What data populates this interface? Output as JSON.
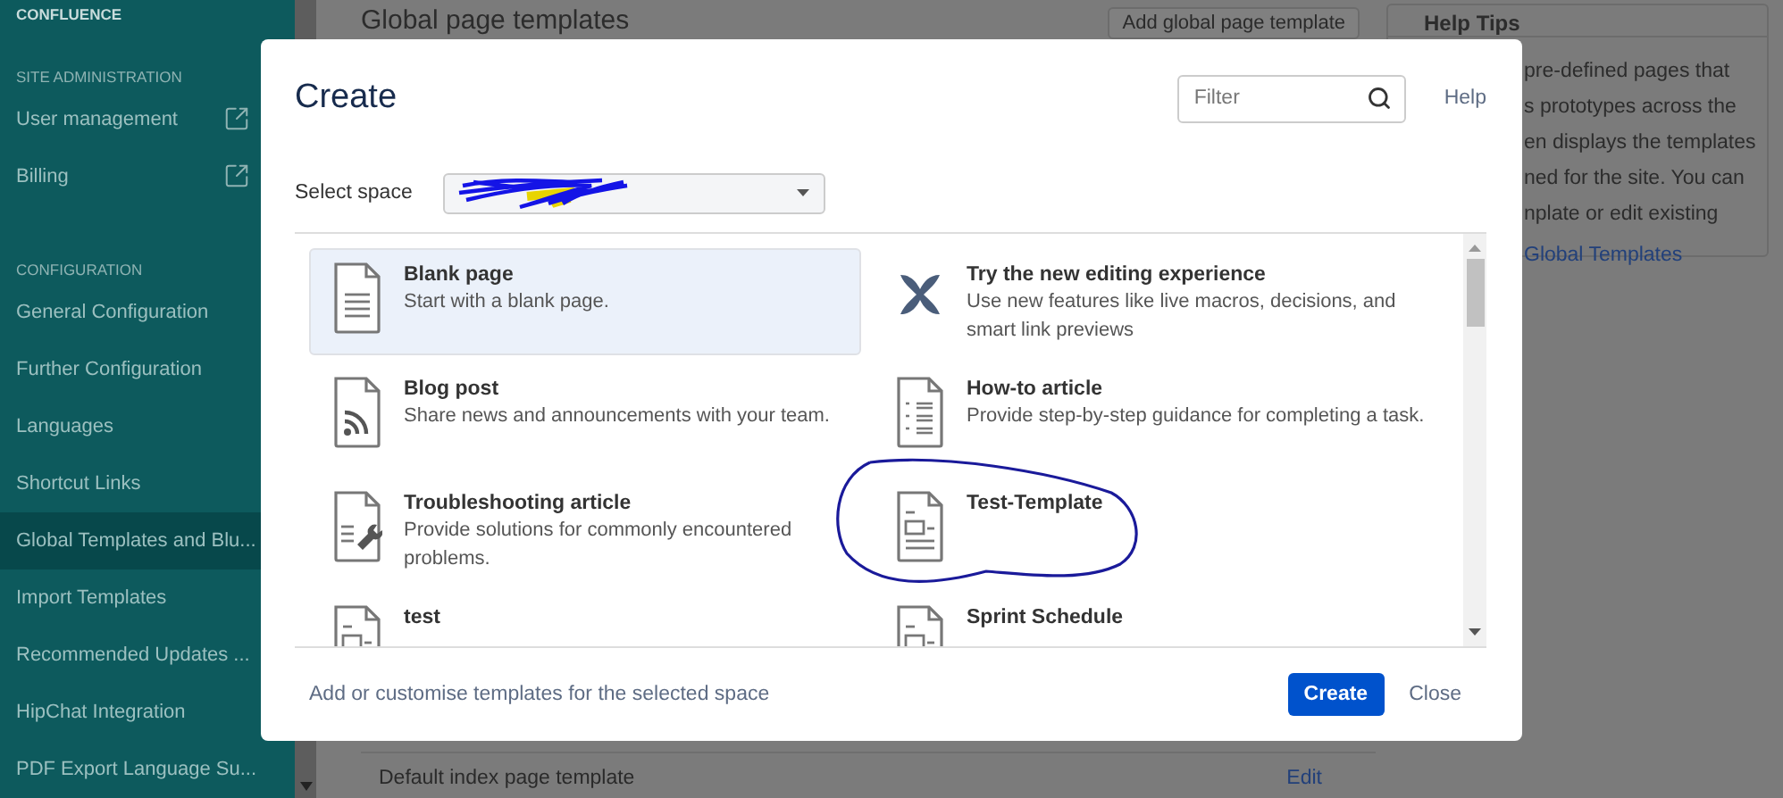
{
  "sidebar": [
    {
      "kind": "title",
      "label": "CONFLUENCE"
    },
    {
      "kind": "heading",
      "label": "SITE ADMINISTRATION"
    },
    {
      "kind": "link",
      "label": "User management",
      "external": true,
      "selected": false
    },
    {
      "kind": "link",
      "label": "Billing",
      "external": true,
      "selected": false
    },
    {
      "kind": "heading",
      "label": "CONFIGURATION"
    },
    {
      "kind": "link",
      "label": "General Configuration",
      "external": false,
      "selected": false
    },
    {
      "kind": "link",
      "label": "Further Configuration",
      "external": false,
      "selected": false
    },
    {
      "kind": "link",
      "label": "Languages",
      "external": false,
      "selected": false
    },
    {
      "kind": "link",
      "label": "Shortcut Links",
      "external": false,
      "selected": false
    },
    {
      "kind": "link",
      "label": "Global Templates and Blu...",
      "external": false,
      "selected": true
    },
    {
      "kind": "link",
      "label": "Import Templates",
      "external": false,
      "selected": false
    },
    {
      "kind": "link",
      "label": "Recommended Updates ...",
      "external": false,
      "selected": false
    },
    {
      "kind": "link",
      "label": "HipChat Integration",
      "external": false,
      "selected": false
    },
    {
      "kind": "link",
      "label": "PDF Export Language Su...",
      "external": false,
      "selected": false
    }
  ],
  "page": {
    "title": "Global page templates",
    "add_button": "Add global page template",
    "help_tips": {
      "title": "Help Tips",
      "lines": [
        "pre-defined pages that",
        "s prototypes across the",
        "en displays the templates",
        "ned for the site. You can",
        "nplate or edit existing"
      ],
      "link": "Global Templates"
    },
    "table_row": {
      "name": "Default index page template",
      "action": "Edit"
    }
  },
  "dialog": {
    "title": "Create",
    "filter": {
      "placeholder": "Filter"
    },
    "help": "Help",
    "space": {
      "label": "Select space"
    },
    "templates": [
      {
        "title": "Blank page",
        "description": "Start with a blank page.",
        "selected": true
      },
      {
        "title": "Try the new editing experience",
        "description": "Use new features like live macros, decisions, and smart link previews",
        "selected": false
      },
      {
        "title": "Blog post",
        "description": "Share news and announcements with your team.",
        "selected": false
      },
      {
        "title": "How-to article",
        "description": "Provide step-by-step guidance for completing a task.",
        "selected": false
      },
      {
        "title": "Troubleshooting article",
        "description": "Provide solutions for commonly encountered problems.",
        "selected": false
      },
      {
        "title": "Test-Template",
        "selected": false
      },
      {
        "title": "test",
        "selected": false
      },
      {
        "title": "Sprint Schedule",
        "selected": false
      }
    ],
    "footer_text": "Add or customise templates for the selected space",
    "create": "Create",
    "close": "Close"
  }
}
